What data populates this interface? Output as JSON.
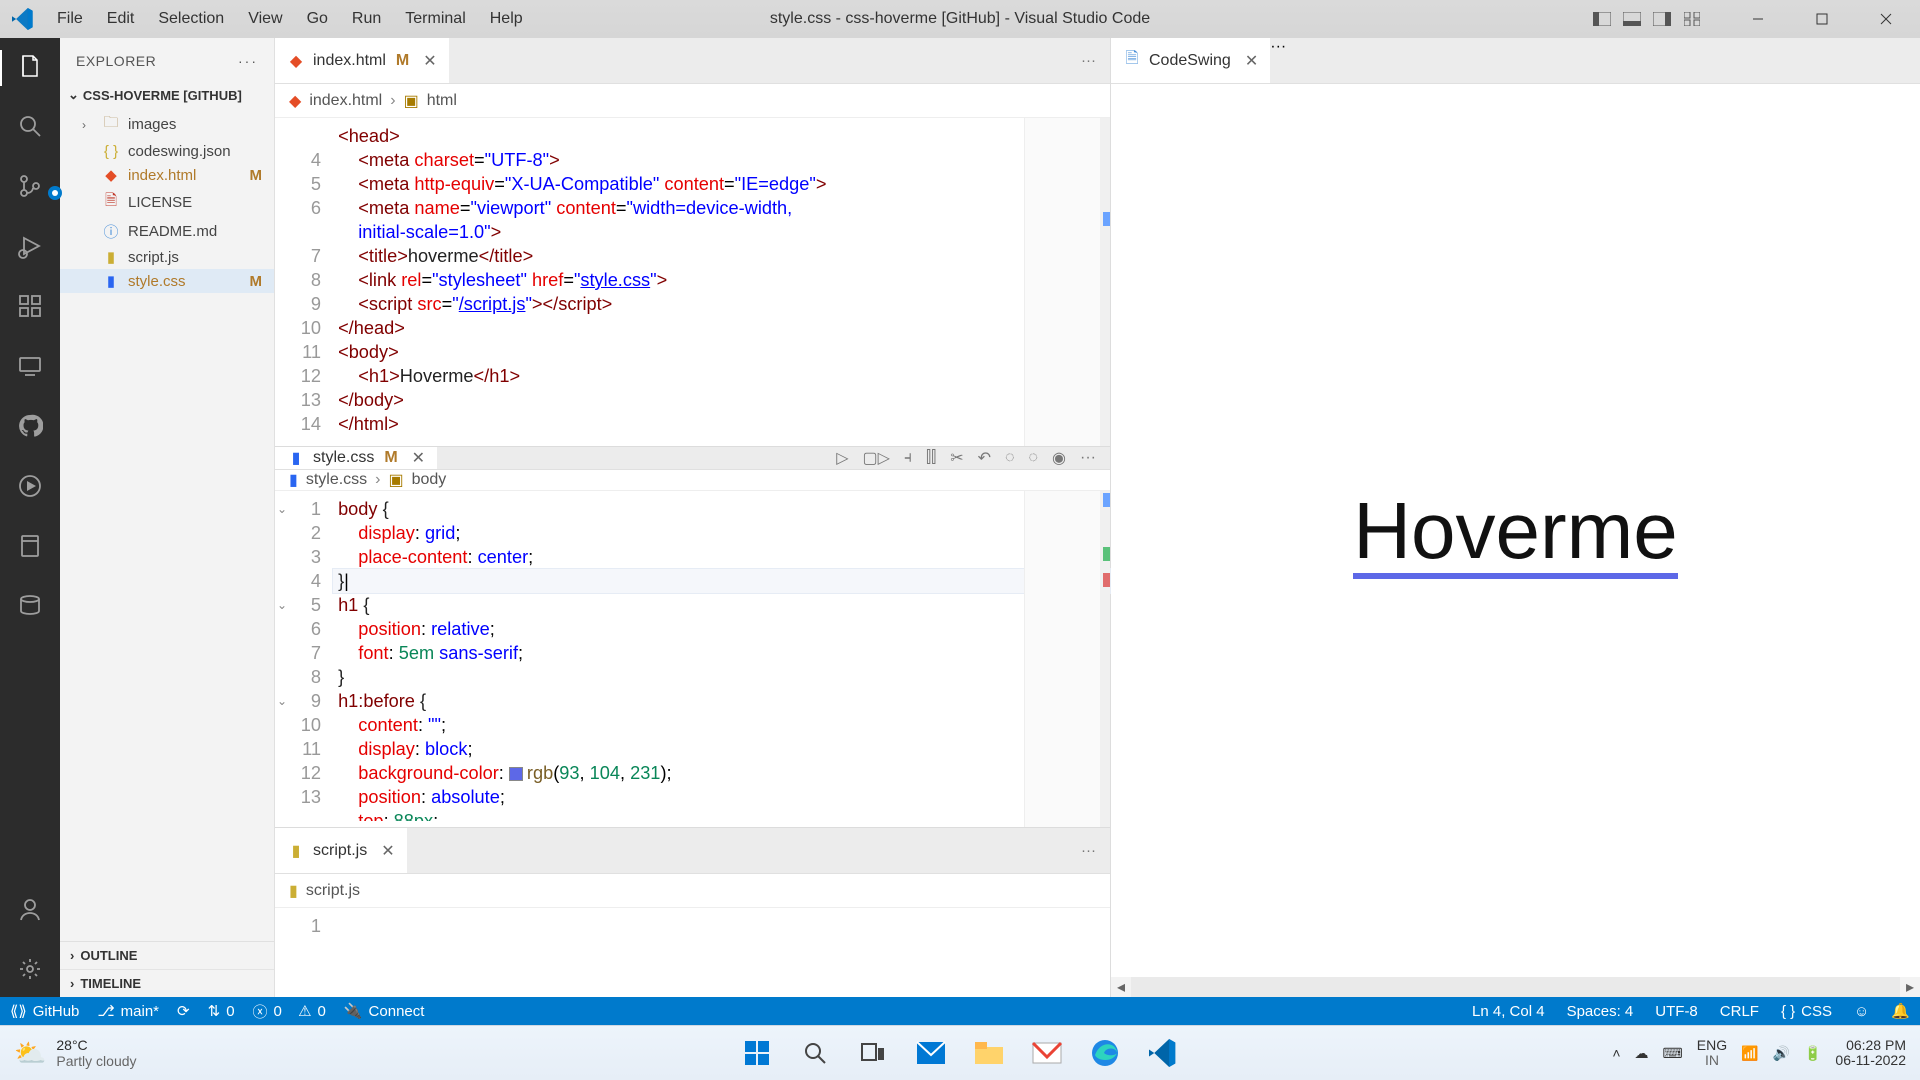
{
  "window": {
    "title": "style.css - css-hoverme [GitHub] - Visual Studio Code"
  },
  "menu": [
    "File",
    "Edit",
    "Selection",
    "View",
    "Go",
    "Run",
    "Terminal",
    "Help"
  ],
  "explorer": {
    "title": "EXPLORER",
    "folder": "CSS-HOVERME [GITHUB]",
    "files": [
      {
        "name": "images",
        "type": "folder",
        "mod": ""
      },
      {
        "name": "codeswing.json",
        "type": "json",
        "mod": ""
      },
      {
        "name": "index.html",
        "type": "html",
        "mod": "M"
      },
      {
        "name": "LICENSE",
        "type": "lic",
        "mod": ""
      },
      {
        "name": "README.md",
        "type": "md",
        "mod": ""
      },
      {
        "name": "script.js",
        "type": "js",
        "mod": ""
      },
      {
        "name": "style.css",
        "type": "css",
        "mod": "M",
        "active": true
      }
    ],
    "sections": [
      "OUTLINE",
      "TIMELINE"
    ]
  },
  "tabs": {
    "groupHtml": {
      "file": "index.html",
      "mod": "M"
    },
    "groupCss": {
      "file": "style.css",
      "mod": "M"
    },
    "groupJs": {
      "file": "script.js",
      "mod": ""
    },
    "preview": {
      "file": "CodeSwing"
    }
  },
  "breadcrumbs": {
    "html": [
      "index.html",
      "html"
    ],
    "css": [
      "style.css",
      "body"
    ],
    "js": [
      "script.js"
    ]
  },
  "gutters": {
    "html": [
      "",
      "4",
      "5",
      "6",
      "",
      "7",
      "8",
      "9",
      "10",
      "11",
      "12",
      "13",
      "14"
    ],
    "css": [
      "1",
      "2",
      "3",
      "4",
      "5",
      "6",
      "7",
      "8",
      "9",
      "10",
      "11",
      "12",
      "13",
      ""
    ]
  },
  "preview_text": "Hoverme",
  "status": {
    "remote": "GitHub",
    "branch": "main*",
    "sync": "",
    "ports": "0",
    "errors": "0",
    "warnings": "0",
    "connect": "Connect",
    "position": "Ln 4, Col 4",
    "spaces": "Spaces: 4",
    "encoding": "UTF-8",
    "eol": "CRLF",
    "language": "CSS",
    "feedback": ""
  },
  "taskbar": {
    "temp": "28°C",
    "cond": "Partly cloudy",
    "lang1": "ENG",
    "lang2": "IN",
    "time": "06:28 PM",
    "date": "06-11-2022"
  }
}
